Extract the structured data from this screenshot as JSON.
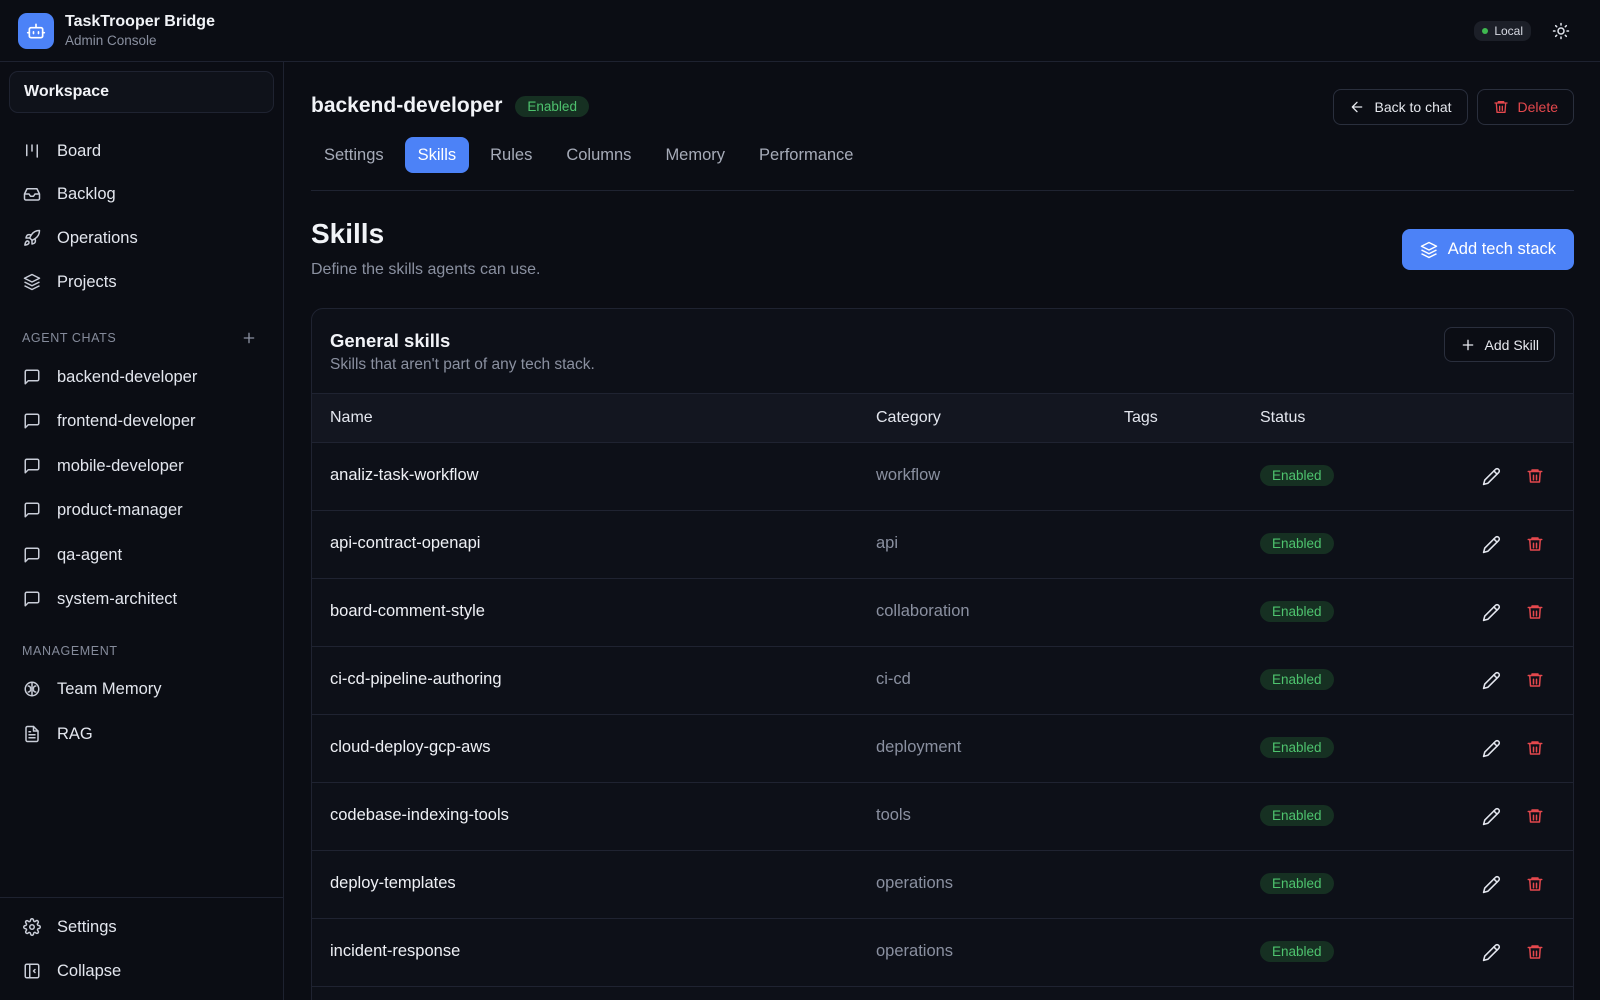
{
  "app": {
    "name": "TaskTrooper Bridge",
    "subtitle": "Admin Console",
    "env_badge": "Local"
  },
  "sidebar": {
    "workspace": "Workspace",
    "nav": [
      {
        "label": "Board",
        "icon": "board-icon"
      },
      {
        "label": "Backlog",
        "icon": "inbox-icon"
      },
      {
        "label": "Operations",
        "icon": "rocket-icon"
      },
      {
        "label": "Projects",
        "icon": "layers-icon"
      }
    ],
    "agent_chats_label": "Agent Chats",
    "agent_chats": [
      "backend-developer",
      "frontend-developer",
      "mobile-developer",
      "product-manager",
      "qa-agent",
      "system-architect"
    ],
    "management_label": "Management",
    "management": [
      {
        "label": "Team Memory",
        "icon": "brain-icon"
      },
      {
        "label": "RAG",
        "icon": "document-icon"
      }
    ],
    "footer": [
      {
        "label": "Settings",
        "icon": "gear-icon"
      },
      {
        "label": "Collapse",
        "icon": "collapse-icon"
      }
    ]
  },
  "agent": {
    "name": "backend-developer",
    "status": "Enabled"
  },
  "actions": {
    "back": "Back to chat",
    "delete": "Delete"
  },
  "tabs": [
    {
      "label": "Settings",
      "active": false
    },
    {
      "label": "Skills",
      "active": true
    },
    {
      "label": "Rules",
      "active": false
    },
    {
      "label": "Columns",
      "active": false
    },
    {
      "label": "Memory",
      "active": false
    },
    {
      "label": "Performance",
      "active": false
    }
  ],
  "skills_section": {
    "title": "Skills",
    "subtitle": "Define the skills agents can use.",
    "add_stack_label": "Add tech stack"
  },
  "general_skills": {
    "title": "General skills",
    "subtitle": "Skills that aren't part of any tech stack.",
    "add_label": "Add Skill",
    "columns": [
      "Name",
      "Category",
      "Tags",
      "Status"
    ],
    "rows": [
      {
        "name": "analiz-task-workflow",
        "category": "workflow",
        "tags": "",
        "status": "Enabled"
      },
      {
        "name": "api-contract-openapi",
        "category": "api",
        "tags": "",
        "status": "Enabled"
      },
      {
        "name": "board-comment-style",
        "category": "collaboration",
        "tags": "",
        "status": "Enabled"
      },
      {
        "name": "ci-cd-pipeline-authoring",
        "category": "ci-cd",
        "tags": "",
        "status": "Enabled"
      },
      {
        "name": "cloud-deploy-gcp-aws",
        "category": "deployment",
        "tags": "",
        "status": "Enabled"
      },
      {
        "name": "codebase-indexing-tools",
        "category": "tools",
        "tags": "",
        "status": "Enabled"
      },
      {
        "name": "deploy-templates",
        "category": "operations",
        "tags": "",
        "status": "Enabled"
      },
      {
        "name": "incident-response",
        "category": "operations",
        "tags": "",
        "status": "Enabled"
      }
    ]
  },
  "colors": {
    "accent": "#4c82f7",
    "success": "#4ec36e",
    "danger": "#e5484d",
    "background": "#0b0d14"
  }
}
